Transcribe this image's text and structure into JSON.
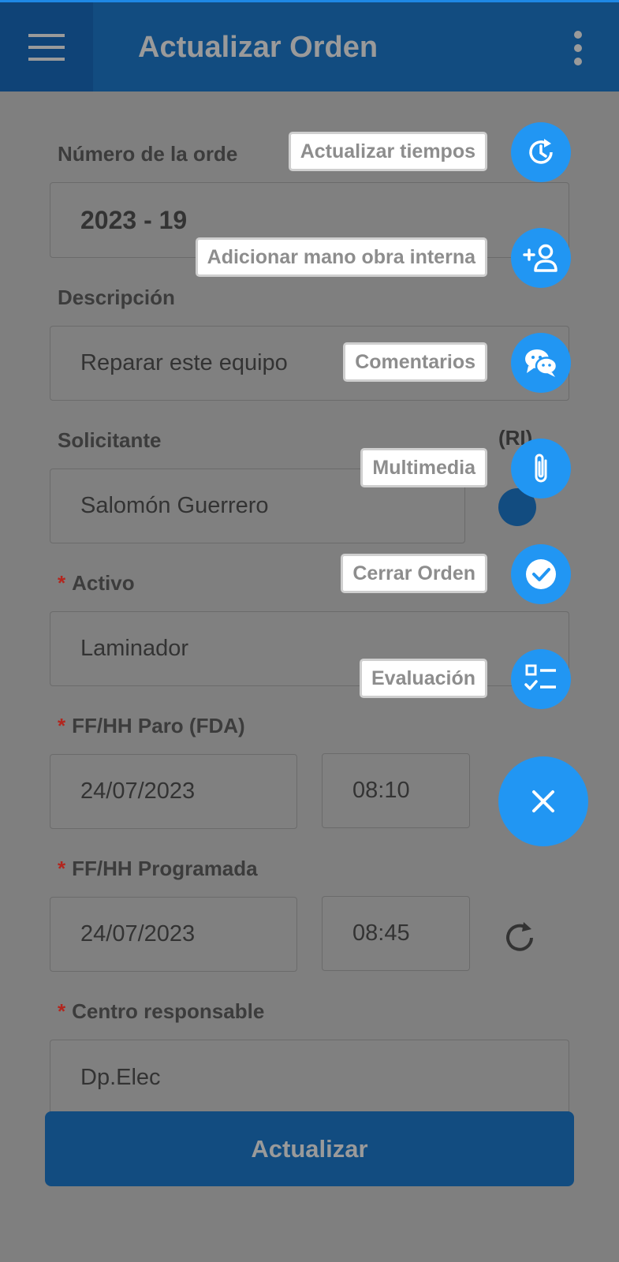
{
  "appbar": {
    "title": "Actualizar Orden",
    "menu_icon": "hamburger-menu-icon",
    "more_icon": "more-vert-icon"
  },
  "form": {
    "order_number": {
      "label": "Número de la orde",
      "value": "2023 - 19"
    },
    "description": {
      "label": "Descripción",
      "value": "Reparar este equipo"
    },
    "requester": {
      "label": "Solicitante",
      "value": "Salomón Guerrero",
      "tag": "(RI)"
    },
    "asset": {
      "label": "Activo",
      "value": "Laminador"
    },
    "stop_datetime": {
      "label": "FF/HH Paro (FDA)",
      "date": "24/07/2023",
      "time": "08:10"
    },
    "scheduled_datetime": {
      "label": "FF/HH Programada",
      "date": "24/07/2023",
      "time": "08:45"
    },
    "responsible_center": {
      "label": "Centro responsable",
      "value": "Dp.Elec"
    },
    "required_marker": "*"
  },
  "actions": {
    "update_button": "Actualizar",
    "speed_dial": [
      {
        "label": "Actualizar tiempos",
        "icon": "history-icon"
      },
      {
        "label": "Adicionar mano obra interna",
        "icon": "add-person-icon"
      },
      {
        "label": "Comentarios",
        "icon": "chat-icon"
      },
      {
        "label": "Multimedia",
        "icon": "attachment-icon"
      },
      {
        "label": "Cerrar Orden",
        "icon": "check-circle-icon"
      },
      {
        "label": "Evaluación",
        "icon": "checklist-icon"
      }
    ],
    "close_icon": "close-icon"
  },
  "colors": {
    "primary": "#124c80",
    "accent": "#2196f3",
    "overlay": "#7f7f7f",
    "required": "#b3261e"
  }
}
